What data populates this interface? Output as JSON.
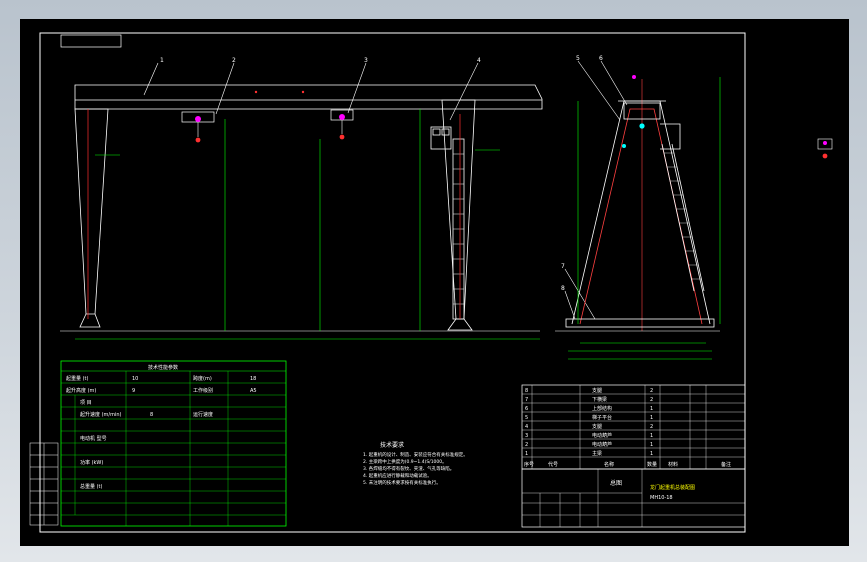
{
  "app": {
    "background": "#000000",
    "frame_color": "#ffffff",
    "line_green": "#00ff00",
    "line_red": "#ff0000",
    "accent_magenta": "#ff00ff",
    "accent_cyan": "#00ffff"
  },
  "balloons": [
    "1",
    "2",
    "3",
    "4",
    "5",
    "6",
    "7",
    "8"
  ],
  "params_table": {
    "header": "技术性能参数",
    "rows_left": [
      [
        "起重量 (t)",
        "10",
        "跨度(m)",
        "18"
      ],
      [
        "起升高度 (m)",
        "9",
        "工作级别",
        "A5"
      ],
      [
        "项 目",
        "",
        "",
        ""
      ],
      [
        "起升速度 (m/min)",
        "8",
        "运行速度",
        ""
      ],
      [
        "电动机 型号",
        "",
        "",
        ""
      ],
      [
        "功率 (kW)",
        "",
        "",
        ""
      ],
      [
        "总重量 (t)",
        "",
        "",
        ""
      ]
    ]
  },
  "tech_requirements": {
    "title": "技术要求",
    "lines": [
      "1. 起重机的设计、制造、安装应符合有关标准规定。",
      "2. 主梁跨中上拱度为(0.9~1.4)S/1000。",
      "3. 各焊缝均不得有裂纹、夹渣、气孔等缺陷。",
      "4. 起重机应进行静载和动载试验。",
      "5. 未注明的技术要求按有关标准执行。"
    ]
  },
  "parts_list": {
    "rows": [
      [
        "8",
        "",
        "支腿",
        "2",
        "",
        ""
      ],
      [
        "7",
        "",
        "下横梁",
        "2",
        "",
        ""
      ],
      [
        "6",
        "",
        "上部结构",
        "1",
        "",
        ""
      ],
      [
        "5",
        "",
        "梯子平台",
        "1",
        "",
        ""
      ],
      [
        "4",
        "",
        "支腿",
        "2",
        "",
        ""
      ],
      [
        "3",
        "",
        "电动葫芦",
        "1",
        "",
        ""
      ],
      [
        "2",
        "",
        "电动葫芦",
        "1",
        "",
        ""
      ],
      [
        "1",
        "",
        "主梁",
        "1",
        "",
        ""
      ]
    ],
    "header": [
      "序号",
      "代号",
      "名称",
      "数量",
      "材料",
      "备注"
    ]
  },
  "title_block": {
    "drawing_name": "总图",
    "product_name": "龙门起重机总装配图",
    "drawing_no": "MH10-18"
  },
  "left_strip": {
    "cells": [
      "",
      "",
      "",
      "",
      "",
      "",
      ""
    ]
  }
}
